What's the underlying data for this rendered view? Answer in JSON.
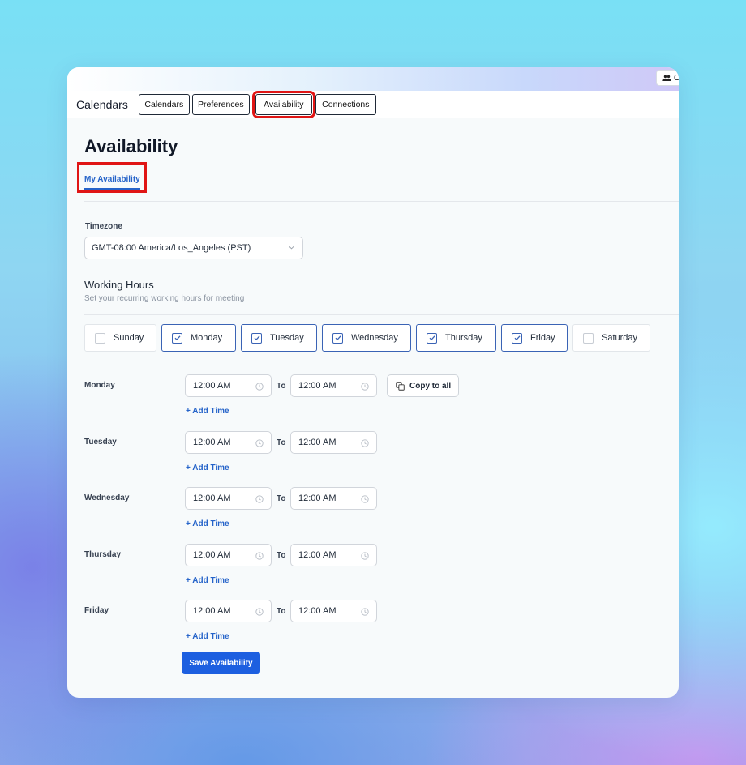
{
  "window": {
    "org_chip_label": "Or"
  },
  "topnav": {
    "brand": "Calendars",
    "tabs": [
      "Calendars",
      "Preferences",
      "Availability",
      "Connections"
    ]
  },
  "page": {
    "title": "Availability",
    "subtab": "My Availability"
  },
  "timezone": {
    "label": "Timezone",
    "value": "GMT-08:00 America/Los_Angeles (PST)"
  },
  "working_hours": {
    "title": "Working Hours",
    "subtitle": "Set your recurring working hours for meeting",
    "days": [
      {
        "label": "Sunday",
        "checked": false
      },
      {
        "label": "Monday",
        "checked": true
      },
      {
        "label": "Tuesday",
        "checked": true
      },
      {
        "label": "Wednesday",
        "checked": true
      },
      {
        "label": "Thursday",
        "checked": true
      },
      {
        "label": "Friday",
        "checked": true
      },
      {
        "label": "Saturday",
        "checked": false
      }
    ]
  },
  "schedule": {
    "to_label": "To",
    "add_time_label": "+ Add Time",
    "copy_all_label": "Copy to all",
    "rows": [
      {
        "day": "Monday",
        "start": "12:00 AM",
        "end": "12:00 AM"
      },
      {
        "day": "Tuesday",
        "start": "12:00 AM",
        "end": "12:00 AM"
      },
      {
        "day": "Wednesday",
        "start": "12:00 AM",
        "end": "12:00 AM"
      },
      {
        "day": "Thursday",
        "start": "12:00 AM",
        "end": "12:00 AM"
      },
      {
        "day": "Friday",
        "start": "12:00 AM",
        "end": "12:00 AM"
      }
    ]
  },
  "actions": {
    "save_label": "Save Availability"
  },
  "colors": {
    "accent": "#1d5fe0",
    "link": "#2563c9",
    "highlight": "#e01515"
  }
}
